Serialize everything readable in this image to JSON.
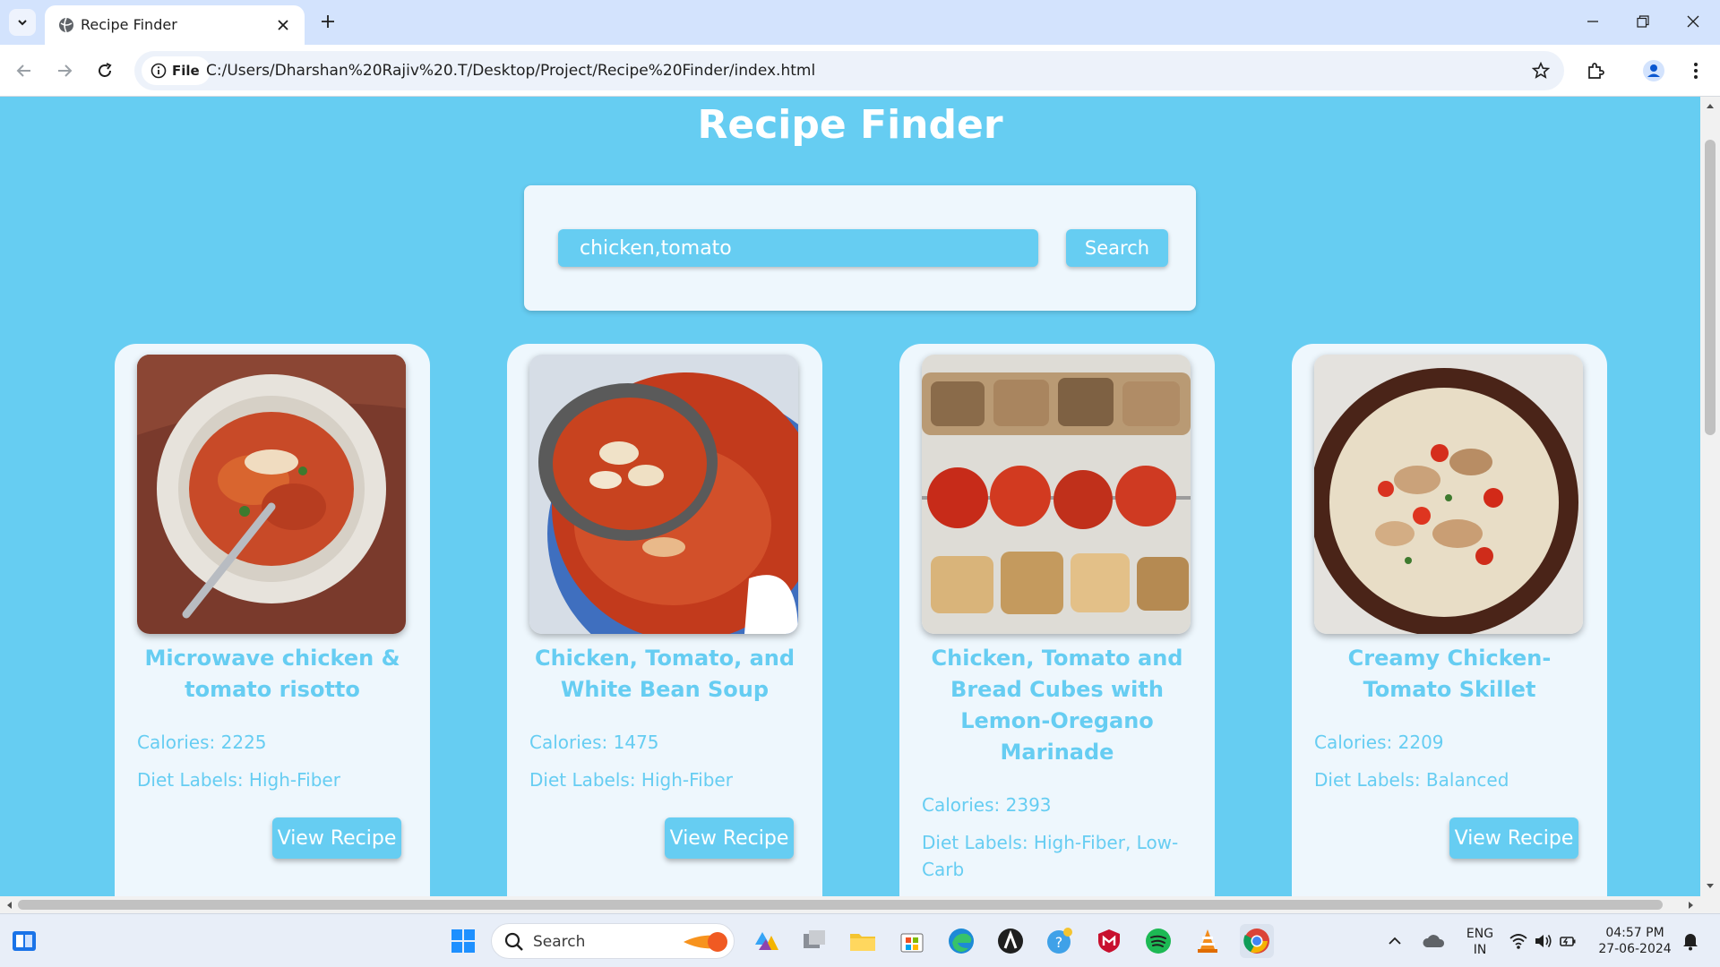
{
  "browser": {
    "tab_title": "Recipe Finder",
    "file_chip": "File",
    "url": "C:/Users/Dharshan%20Rajiv%20.T/Desktop/Project/Recipe%20Finder/index.html"
  },
  "page": {
    "title": "Recipe Finder",
    "search_value": "chicken,tomato",
    "search_button": "Search"
  },
  "recipes": [
    {
      "name": "Microwave chicken & tomato risotto",
      "calories": "Calories: 2225",
      "diet": "Diet Labels: High-Fiber",
      "button": "View Recipe",
      "image": "risotto-bowl"
    },
    {
      "name": "Chicken, Tomato, and White Bean Soup",
      "calories": "Calories: 1475",
      "diet": "Diet Labels: High-Fiber",
      "button": "View Recipe",
      "image": "soup-pot"
    },
    {
      "name": "Chicken, Tomato and Bread Cubes with Lemon-Oregano Marinade",
      "calories": "Calories: 2393",
      "diet": "Diet Labels: High-Fiber, Low-Carb",
      "button": "View Recipe",
      "image": "skewers"
    },
    {
      "name": "Creamy Chicken-Tomato Skillet",
      "calories": "Calories: 2209",
      "diet": "Diet Labels: Balanced",
      "button": "View Recipe",
      "image": "skillet"
    }
  ],
  "taskbar": {
    "search_label": "Search",
    "lang_top": "ENG",
    "lang_bottom": "IN",
    "time": "04:57 PM",
    "date": "27-06-2024"
  },
  "colors": {
    "page_bg": "#66cdf2",
    "card_bg": "#eef7fd",
    "accent_text": "#66cdf2"
  }
}
